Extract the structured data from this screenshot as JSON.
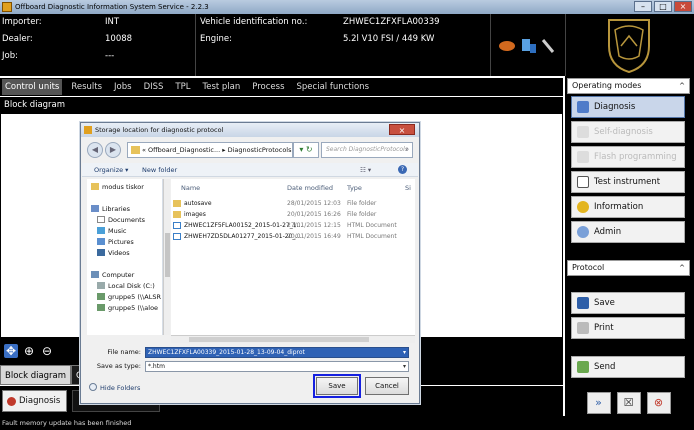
{
  "window": {
    "title": "Offboard Diagnostic Information System Service - 2.2.3"
  },
  "header": {
    "importer_label": "Importer:",
    "importer_value": "INT",
    "dealer_label": "Dealer:",
    "dealer_value": "10088",
    "job_label": "Job:",
    "job_value": "---",
    "vin_label": "Vehicle identification no.:",
    "vin_value": "ZHWEC1ZFXFLA00339",
    "engine_label": "Engine:",
    "engine_value": "5.2l V10 FSI / 449 KW"
  },
  "nav_tabs": [
    "Control units",
    "Results",
    "Jobs",
    "DISS",
    "TPL",
    "Test plan",
    "Process",
    "Special functions"
  ],
  "main": {
    "block_diagram_title": "Block diagram"
  },
  "bottom_tabs": {
    "block_diagram": "Block diagram",
    "other": "C"
  },
  "diag_tab": {
    "label": "Diagnosis"
  },
  "operating_modes": {
    "title": "Operating modes",
    "items": [
      {
        "label": "Diagnosis",
        "state": "selected"
      },
      {
        "label": "Self-diagnosis",
        "state": "disabled"
      },
      {
        "label": "Flash programming",
        "state": "disabled"
      },
      {
        "label": "Test instrument",
        "state": "normal"
      },
      {
        "label": "Information",
        "state": "normal"
      },
      {
        "label": "Admin",
        "state": "normal"
      }
    ]
  },
  "protocol": {
    "title": "Protocol",
    "save": "Save",
    "print": "Print",
    "send": "Send"
  },
  "status_bar": "Fault memory update has been finished",
  "dialog": {
    "title": "Storage location for diagnostic protocol",
    "address": "« Offboard_Diagnostic... ▸ DiagnosticProtocols ▸",
    "search_placeholder": "Search DiagnosticProtocols",
    "toolbar": {
      "organize": "Organize ▾",
      "new_folder": "New folder"
    },
    "nav_items": [
      "modus tiskor",
      "Libraries",
      "Documents",
      "Music",
      "Pictures",
      "Videos",
      "Computer",
      "Local Disk (C:)",
      "gruppe5 (\\\\ALSR",
      "gruppe5 (\\\\aloe"
    ],
    "columns": {
      "name": "Name",
      "date": "Date modified",
      "type": "Type",
      "size": "Si"
    },
    "files": [
      {
        "name": "autosave",
        "date": "28/01/2015 12:03",
        "type": "File folder",
        "icon": "folder"
      },
      {
        "name": "images",
        "date": "20/01/2015 16:26",
        "type": "File folder",
        "icon": "folder"
      },
      {
        "name": "ZHWEC1ZF5FLA00152_2015-01-27_1...",
        "date": "27/01/2015 12:15",
        "type": "HTML Document",
        "icon": "html"
      },
      {
        "name": "ZHWEH7ZD5DLA01277_2015-01-20_...",
        "date": "20/01/2015 16:49",
        "type": "HTML Document",
        "icon": "html"
      }
    ],
    "file_name_label": "File name:",
    "file_name_value": "ZHWEC1ZFXFLA00339_2015-01-28_13-09-04_diprot",
    "save_type_label": "Save as type:",
    "save_type_value": "*.htm",
    "hide_folders": "Hide Folders",
    "save_button": "Save",
    "cancel_button": "Cancel"
  },
  "colors": {
    "header_bg": "#000000",
    "selection_blue": "#2f62b5",
    "highlight_box": "#1520e0"
  }
}
